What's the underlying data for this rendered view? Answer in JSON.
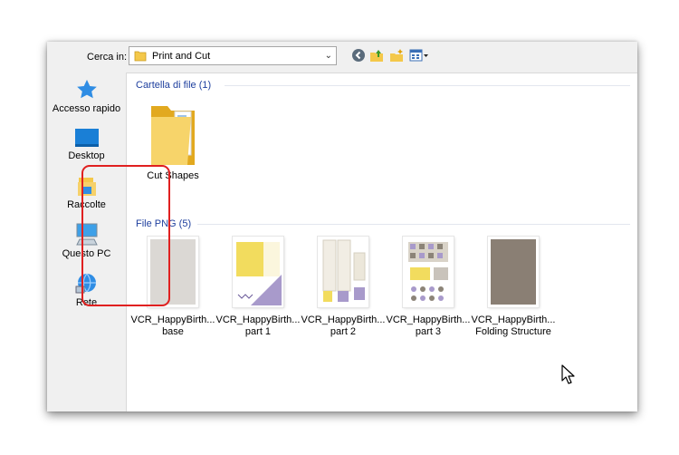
{
  "toolbar": {
    "lookin_label": "Cerca in:",
    "location": "Print and Cut",
    "icons": [
      "back-icon",
      "up-folder-icon",
      "new-folder-icon",
      "view-menu-icon"
    ]
  },
  "places": [
    {
      "label": "Accesso rapido",
      "icon": "star-icon"
    },
    {
      "label": "Desktop",
      "icon": "desktop-icon"
    },
    {
      "label": "Raccolte",
      "icon": "libraries-icon"
    },
    {
      "label": "Questo PC",
      "icon": "computer-icon"
    },
    {
      "label": "Rete",
      "icon": "network-icon"
    }
  ],
  "groups": {
    "folders": {
      "header": "Cartella di file (1)",
      "items": [
        {
          "name": "Cut Shapes"
        }
      ]
    },
    "png": {
      "header": "File PNG (5)",
      "items": [
        {
          "line1": "VCR_HappyBirth...",
          "line2": "base"
        },
        {
          "line1": "VCR_HappyBirth...",
          "line2": "part 1"
        },
        {
          "line1": "VCR_HappyBirth...",
          "line2": "part 2"
        },
        {
          "line1": "VCR_HappyBirth...",
          "line2": "part 3"
        },
        {
          "line1": "VCR_HappyBirth...",
          "line2": "Folding Structure"
        }
      ]
    }
  },
  "colors": {
    "group_header": "#1e3f9e",
    "highlight": "#e02020",
    "folder": "#f4c84a"
  }
}
